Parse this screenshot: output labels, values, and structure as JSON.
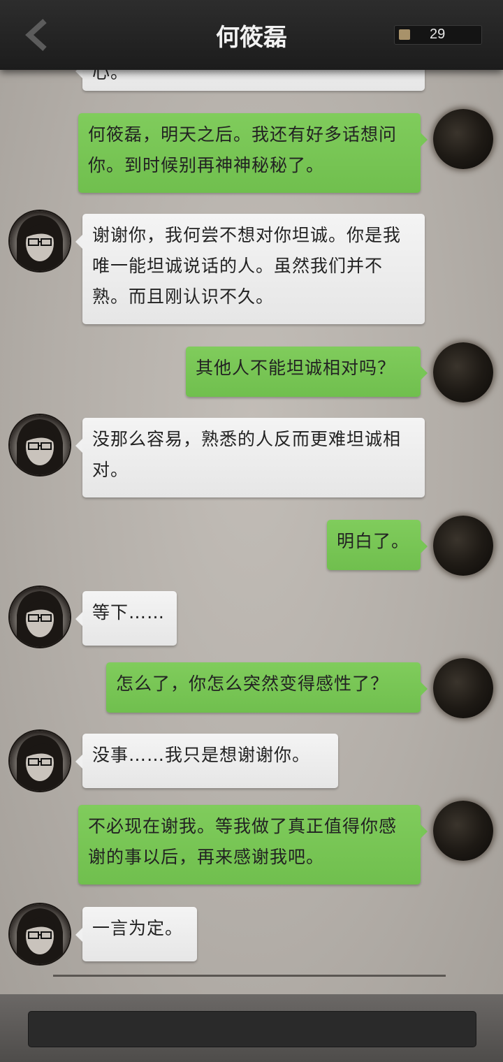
{
  "header": {
    "title": "何筱磊",
    "coins": "29"
  },
  "messages": [
    {
      "side": "left",
      "text": "心。"
    },
    {
      "side": "right",
      "text": "何筱磊，明天之后。我还有好多话想问你。到时候别再神神秘秘了。"
    },
    {
      "side": "left",
      "text": "谢谢你，我何尝不想对你坦诚。你是我唯一能坦诚说话的人。虽然我们并不熟。而且刚认识不久。"
    },
    {
      "side": "right",
      "text": "其他人不能坦诚相对吗？"
    },
    {
      "side": "left",
      "text": "没那么容易，熟悉的人反而更难坦诚相对。"
    },
    {
      "side": "right",
      "text": "明白了。"
    },
    {
      "side": "left",
      "text": "等下……"
    },
    {
      "side": "right",
      "text": "怎么了，你怎么突然变得感性了？"
    },
    {
      "side": "left",
      "text": "没事……我只是想谢谢你。"
    },
    {
      "side": "right",
      "text": "不必现在谢我。等我做了真正值得你感谢的事以后，再来感谢我吧。"
    },
    {
      "side": "left",
      "text": "一言为定。"
    }
  ],
  "input": {
    "placeholder": ""
  }
}
